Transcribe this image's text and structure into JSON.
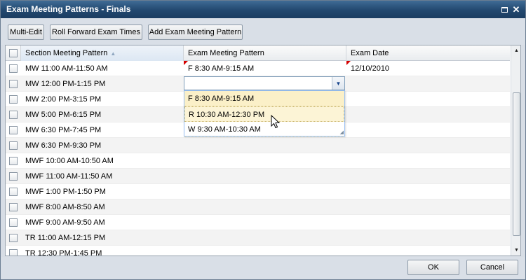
{
  "window": {
    "title": "Exam Meeting Patterns - Finals"
  },
  "toolbar": {
    "multi_edit": "Multi-Edit",
    "roll_forward": "Roll Forward Exam Times",
    "add_pattern": "Add Exam Meeting Pattern"
  },
  "grid": {
    "columns": {
      "section_meeting_pattern": "Section Meeting Pattern",
      "exam_meeting_pattern": "Exam Meeting Pattern",
      "exam_date": "Exam Date"
    },
    "sorted_column": "Section Meeting Pattern",
    "sort_direction": "ascending",
    "rows": [
      {
        "smp": "MW 11:00 AM-11:50 AM",
        "emp": "F 8:30 AM-9:15 AM",
        "date": "12/10/2010"
      },
      {
        "smp": "MW 12:00 PM-1:15 PM",
        "emp": "",
        "date": ""
      },
      {
        "smp": "MW 2:00 PM-3:15 PM",
        "emp": "",
        "date": ""
      },
      {
        "smp": "MW 5:00 PM-6:15 PM",
        "emp": "",
        "date": ""
      },
      {
        "smp": "MW 6:30 PM-7:45 PM",
        "emp": "",
        "date": ""
      },
      {
        "smp": "MW 6:30 PM-9:30 PM",
        "emp": "",
        "date": ""
      },
      {
        "smp": "MWF 10:00 AM-10:50 AM",
        "emp": "",
        "date": ""
      },
      {
        "smp": "MWF 11:00 AM-11:50 AM",
        "emp": "",
        "date": ""
      },
      {
        "smp": "MWF 1:00 PM-1:50 PM",
        "emp": "",
        "date": ""
      },
      {
        "smp": "MWF 8:00 AM-8:50 AM",
        "emp": "",
        "date": ""
      },
      {
        "smp": "MWF 9:00 AM-9:50 AM",
        "emp": "",
        "date": ""
      },
      {
        "smp": "TR 11:00 AM-12:15 PM",
        "emp": "",
        "date": ""
      },
      {
        "smp": "TR 12:30 PM-1:45 PM",
        "emp": "",
        "date": ""
      }
    ]
  },
  "editor": {
    "value": "",
    "options": [
      "F 8:30 AM-9:15 AM",
      "R 10:30 AM-12:30 PM",
      "W 9:30 AM-10:30 AM"
    ],
    "selected_option": "F 8:30 AM-9:15 AM",
    "hovered_option": "R 10:30 AM-12:30 PM"
  },
  "footer": {
    "ok": "OK",
    "cancel": "Cancel"
  },
  "colors": {
    "titlebar": "#22486f",
    "dirty_marker": "#d40000",
    "selected_option": "#fbf0c8"
  }
}
